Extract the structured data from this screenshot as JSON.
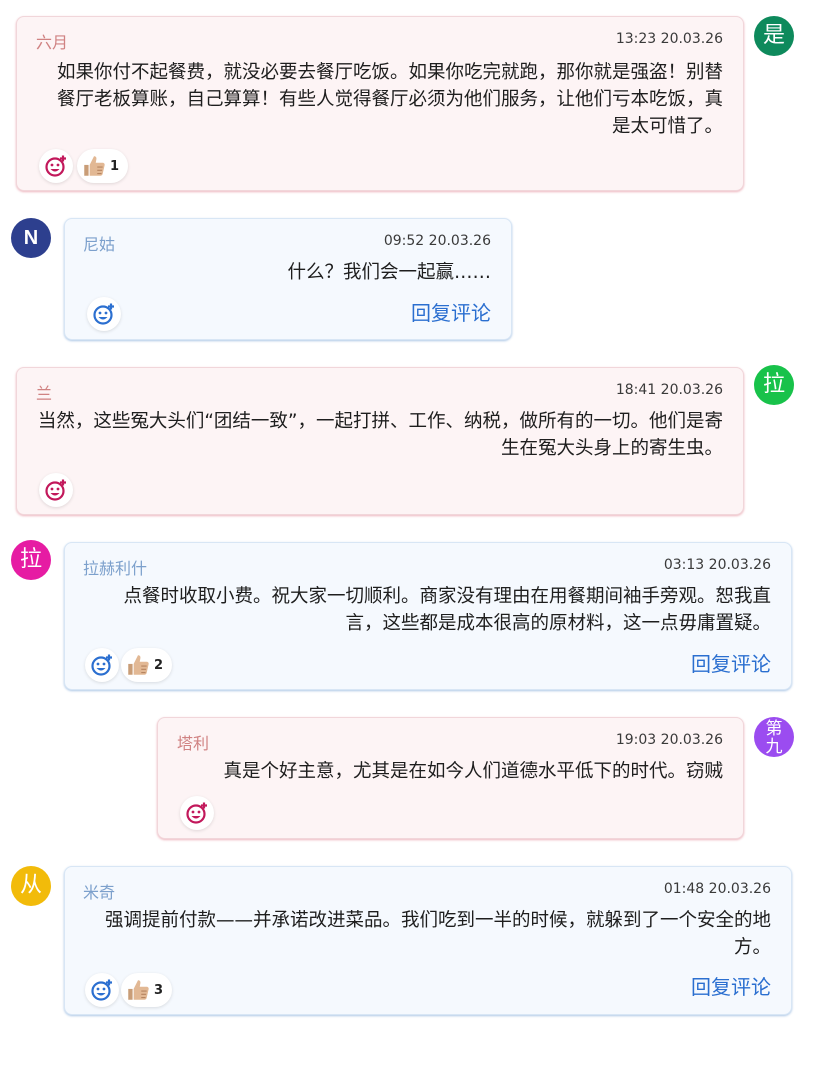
{
  "comments": [
    {
      "author": "六月",
      "time": "13:23 20.03.26",
      "text": "如果你付不起餐费，就没必要去餐厅吃饭。如果你吃完就跑，那你就是强盗！别替餐厅老板算账，自己算算！有些人觉得餐厅必须为他们服务，让他们亏本吃饭，真是太可惜了。",
      "likes": "1",
      "avatar_letter": "是",
      "avatar_color": "#0e8a5c"
    },
    {
      "author": "尼姑",
      "time": "09:52 20.03.26",
      "text": "什么？我们会一起赢……",
      "reply": "回复评论",
      "avatar_letter": "N",
      "avatar_color": "#2d3f8e"
    },
    {
      "author": "兰",
      "time": "18:41 20.03.26",
      "text": "当然，这些冤大头们“团结一致”，一起打拼、工作、纳税，做所有的一切。他们是寄生在冤大头身上的寄生虫。",
      "avatar_letter": "拉",
      "avatar_color": "#18c24a"
    },
    {
      "author": "拉赫利什",
      "time": "03:13 20.03.26",
      "text": "点餐时收取小费。祝大家一切顺利。商家没有理由在用餐期间袖手旁观。恕我直言，这些都是成本很高的原材料，这一点毋庸置疑。",
      "likes": "2",
      "reply": "回复评论",
      "avatar_letter": "拉",
      "avatar_color": "#e61ca3"
    },
    {
      "author": "塔利",
      "time": "19:03 20.03.26",
      "text": "真是个好主意，尤其是在如今人们道德水平低下的时代。窃贼",
      "avatar_letter": "第九",
      "avatar_color": "#9b4cf0"
    },
    {
      "author": "米奇",
      "time": "01:48 20.03.26",
      "text": "强调提前付款——并承诺改进菜品。我们吃到一半的时候，就躲到了一个安全的地方。",
      "likes": "3",
      "reply": "回复评论",
      "avatar_letter": "从",
      "avatar_color": "#f2bb0a"
    }
  ],
  "icons": {
    "add_reaction": "add-reaction-icon",
    "thumbs_up": "thumbs-up-icon"
  },
  "colors": {
    "pink_card": "#fdf4f5",
    "blue_card": "#f5f9fe",
    "reply_link": "#2b6fd0",
    "reaction_pink": "#c2185b",
    "reaction_blue": "#2b6fd0"
  }
}
